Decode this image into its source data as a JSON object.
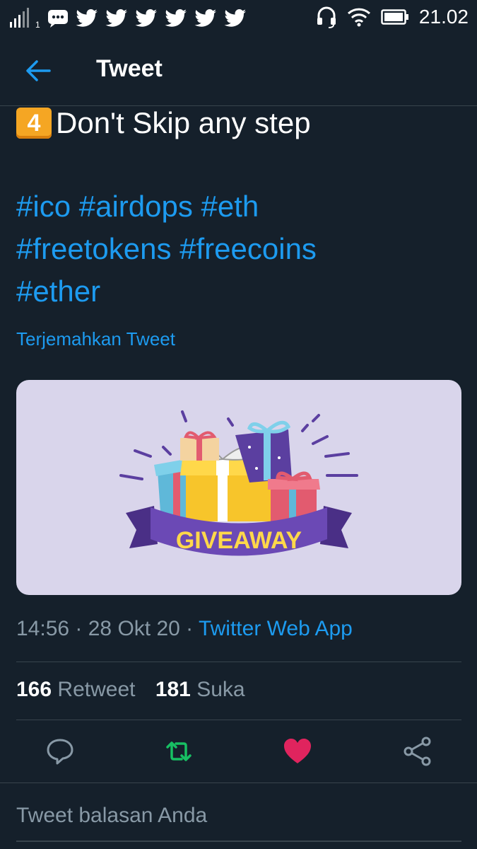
{
  "status_bar": {
    "sim_label": "1",
    "notification_icons": [
      "chat-bubble-icon",
      "twitter-bird-icon",
      "twitter-bird-icon",
      "twitter-bird-icon",
      "twitter-bird-icon",
      "twitter-bird-icon",
      "twitter-bird-icon"
    ],
    "time": "21.02"
  },
  "header": {
    "title": "Tweet"
  },
  "tweet": {
    "keycap_digit": "4",
    "text_line": "Don't Skip any step",
    "hashtags": [
      "#ico",
      "#airdops",
      "#eth",
      "#freetokens",
      "#freecoins",
      "#ether"
    ],
    "translate_label": "Terjemahkan Tweet",
    "image_caption": "GIVEAWAY",
    "time": "14:56",
    "date": "28 Okt 20",
    "source": "Twitter Web App",
    "retweet_count": "166",
    "retweet_label": "Retweet",
    "like_count": "181",
    "like_label": "Suka"
  },
  "reply": {
    "placeholder": "Tweet balasan Anda"
  },
  "colors": {
    "background": "#15202b",
    "accent": "#1d9bf0",
    "muted": "#8899a6",
    "retweet_green": "#17bf63",
    "like_red": "#e0245e",
    "divider": "#38444d"
  }
}
